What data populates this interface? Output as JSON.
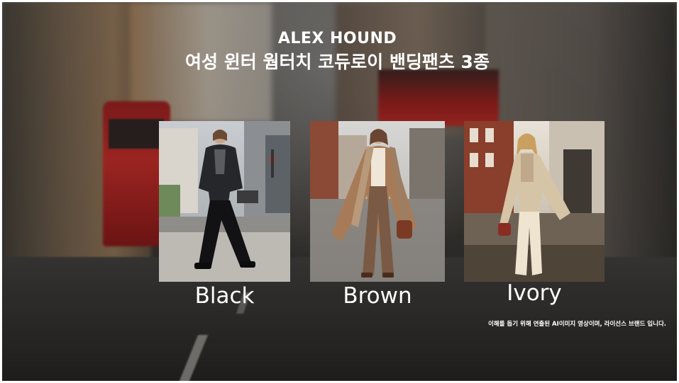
{
  "header": {
    "brand": "ALEX HOUND",
    "title": "여성 윈터 웜터치 코듀로이 밴딩팬츠 3종"
  },
  "products": [
    {
      "label": "Black"
    },
    {
      "label": "Brown"
    },
    {
      "label": "Ivory"
    }
  ],
  "footer": {
    "disclaimer": "이해를 돕기 위해 연출된 AI이미지 영상이며, 라이선스 브랜드 입니다."
  }
}
